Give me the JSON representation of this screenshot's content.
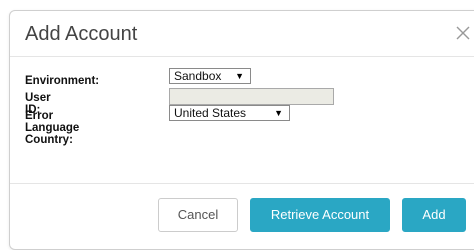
{
  "dialog": {
    "title": "Add Account",
    "close_icon": "close-icon"
  },
  "form": {
    "environment": {
      "label": "Environment:",
      "value": "Sandbox"
    },
    "user_id": {
      "label": "User ID:",
      "value": ""
    },
    "error_language_country": {
      "label": "Error Language Country:",
      "value": "United States"
    }
  },
  "buttons": {
    "cancel": "Cancel",
    "retrieve": "Retrieve Account",
    "add": "Add"
  },
  "colors": {
    "primary": "#2aa7c4",
    "disabled_input": "#ebebe4"
  }
}
